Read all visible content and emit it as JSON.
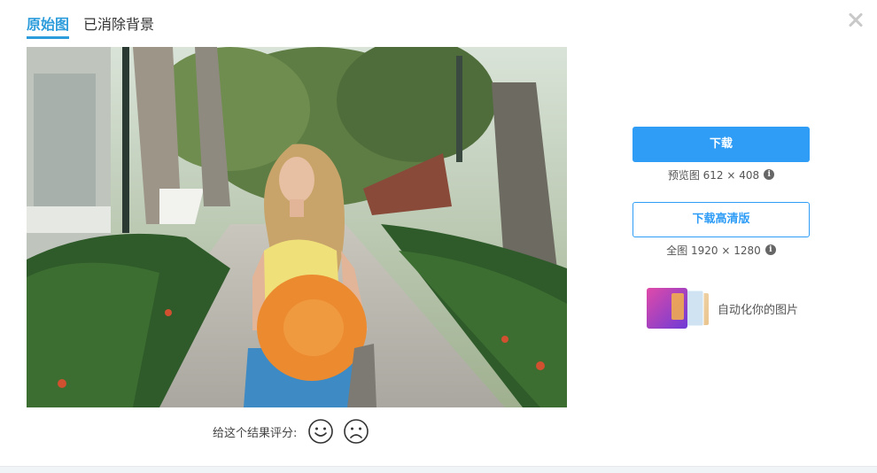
{
  "tabs": [
    {
      "label": "原始图",
      "active": true
    },
    {
      "label": "已消除背景",
      "active": false
    }
  ],
  "rating": {
    "label": "给这个结果评分:"
  },
  "download": {
    "button_label": "下载",
    "preview_info": "预览图 612 × 408",
    "hd_button_label": "下载高清版",
    "full_info": "全图 1920 × 1280"
  },
  "promo": {
    "text": "自动化你的图片"
  },
  "colors": {
    "accent": "#2f9df6",
    "tab_active": "#2d9cdb"
  }
}
